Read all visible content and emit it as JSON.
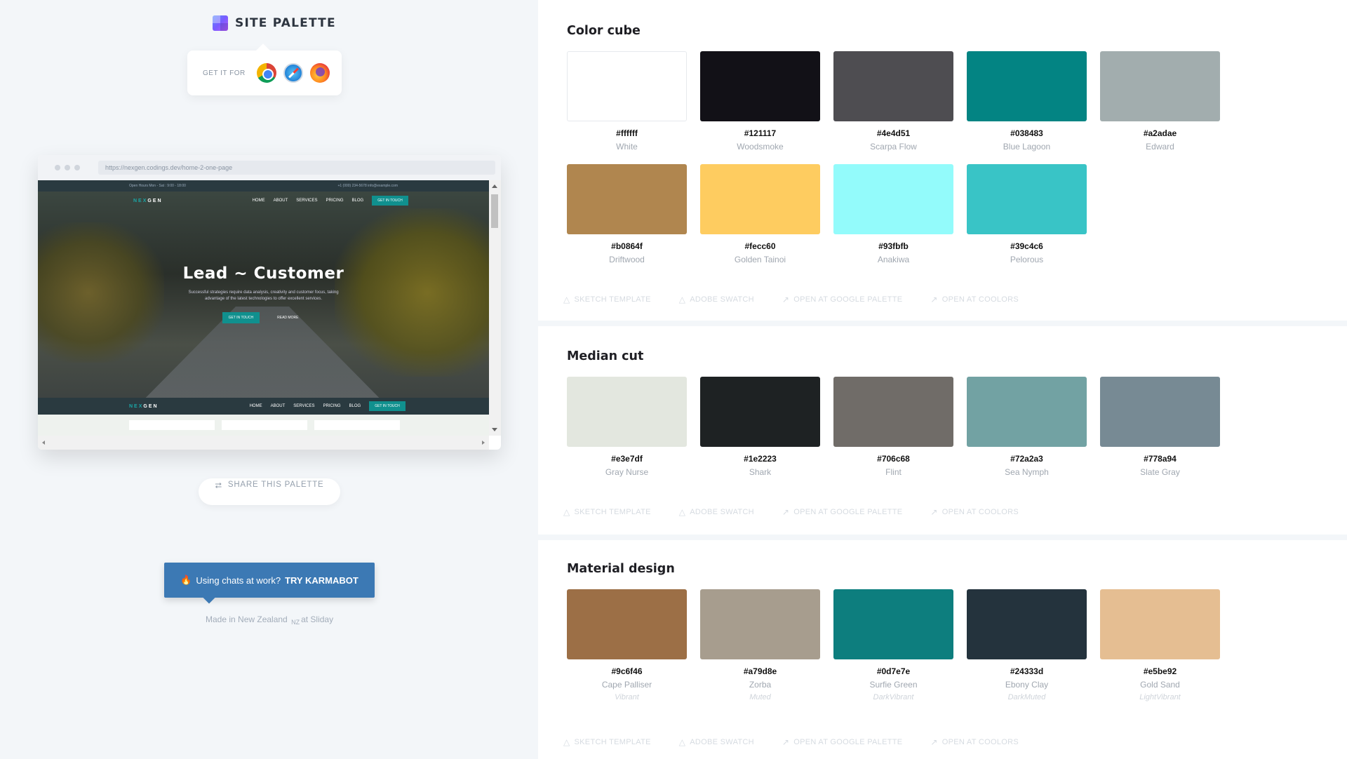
{
  "brand": {
    "name": "SITE PALETTE"
  },
  "get_it": {
    "label": "GET IT FOR"
  },
  "preview": {
    "url": "https://nexgen.codings.dev/home-2-one-page",
    "topbar_left": "Open Hours Mon - Sat : 9:00 - 18:00",
    "topbar_right": "+1 (000) 234-5678   info@example.com",
    "logo_a": "NEX",
    "logo_b": "GEN",
    "nav": [
      "HOME",
      "ABOUT",
      "SERVICES",
      "PRICING",
      "BLOG"
    ],
    "cta": "GET IN TOUCH",
    "hero_title": "Lead ~ Customer",
    "hero_sub_1": "Successful strategies require data analysis, creativity and customer focus, taking",
    "hero_sub_2": "advantage of the latest technologies to offer excellent services.",
    "btn_primary": "GET IN TOUCH",
    "btn_secondary": "READ MORE"
  },
  "share": {
    "label": "SHARE THIS PALETTE"
  },
  "karma": {
    "prefix": "Using chats at work?",
    "strong": "TRY KARMABOT"
  },
  "footer": {
    "made_in": "Made in New Zealand",
    "nz": "NZ",
    "at": "at Sliday"
  },
  "actions": {
    "sketch": "SKETCH TEMPLATE",
    "adobe": "ADOBE SWATCH",
    "google": "OPEN AT GOOGLE PALETTE",
    "coolors": "OPEN AT COOLORS"
  },
  "sections": [
    {
      "title": "Color cube",
      "swatches": [
        {
          "hex": "#ffffff",
          "name": "White",
          "kind": ""
        },
        {
          "hex": "#121117",
          "name": "Woodsmoke",
          "kind": ""
        },
        {
          "hex": "#4e4d51",
          "name": "Scarpa Flow",
          "kind": ""
        },
        {
          "hex": "#038483",
          "name": "Blue Lagoon",
          "kind": ""
        },
        {
          "hex": "#a2adae",
          "name": "Edward",
          "kind": ""
        },
        {
          "hex": "#b0864f",
          "name": "Driftwood",
          "kind": ""
        },
        {
          "hex": "#fecc60",
          "name": "Golden Tainoi",
          "kind": ""
        },
        {
          "hex": "#93fbfb",
          "name": "Anakiwa",
          "kind": ""
        },
        {
          "hex": "#39c4c6",
          "name": "Pelorous",
          "kind": ""
        }
      ]
    },
    {
      "title": "Median cut",
      "swatches": [
        {
          "hex": "#e3e7df",
          "name": "Gray Nurse",
          "kind": ""
        },
        {
          "hex": "#1e2223",
          "name": "Shark",
          "kind": ""
        },
        {
          "hex": "#706c68",
          "name": "Flint",
          "kind": ""
        },
        {
          "hex": "#72a2a3",
          "name": "Sea Nymph",
          "kind": ""
        },
        {
          "hex": "#778a94",
          "name": "Slate Gray",
          "kind": ""
        }
      ]
    },
    {
      "title": "Material design",
      "swatches": [
        {
          "hex": "#9c6f46",
          "name": "Cape Palliser",
          "kind": "Vibrant"
        },
        {
          "hex": "#a79d8e",
          "name": "Zorba",
          "kind": "Muted"
        },
        {
          "hex": "#0d7e7e",
          "name": "Surfie Green",
          "kind": "DarkVibrant"
        },
        {
          "hex": "#24333d",
          "name": "Ebony Clay",
          "kind": "DarkMuted"
        },
        {
          "hex": "#e5be92",
          "name": "Gold Sand",
          "kind": "LightVibrant"
        }
      ]
    }
  ]
}
